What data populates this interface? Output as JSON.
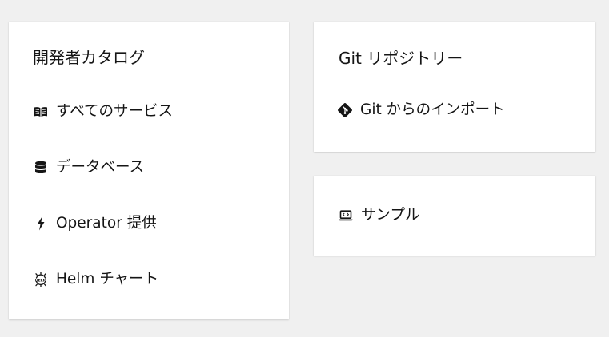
{
  "catalog": {
    "title": "開発者カタログ",
    "items": [
      {
        "label": "すべてのサービス",
        "icon": "book-open-icon"
      },
      {
        "label": "データベース",
        "icon": "database-icon"
      },
      {
        "label": "Operator 提供",
        "icon": "bolt-icon"
      },
      {
        "label": "Helm チャート",
        "icon": "helm-icon",
        "icon_text": "HELM"
      }
    ]
  },
  "git": {
    "title": "Git リポジトリー",
    "items": [
      {
        "label": "Git からのインポート",
        "icon": "git-icon"
      }
    ]
  },
  "samples": {
    "items": [
      {
        "label": "サンプル",
        "icon": "laptop-code-icon"
      }
    ]
  }
}
